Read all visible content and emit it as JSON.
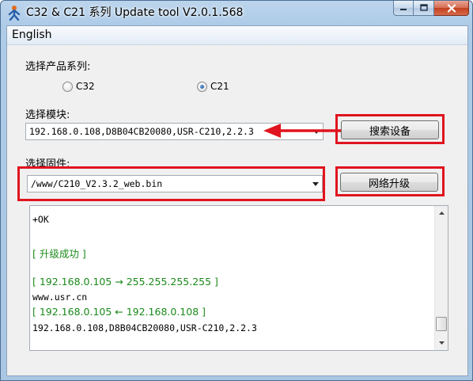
{
  "window": {
    "title": "C32 & C21 系列 Update tool V2.0.1.568"
  },
  "menu": {
    "language": "English"
  },
  "product": {
    "label": "选择产品系列:",
    "options": [
      "C32",
      "C21"
    ],
    "selected": "C21"
  },
  "module": {
    "label": "选择模块:",
    "value": "192.168.0.108,D8B04CB20080,USR-C210,2.2.3",
    "search_button": "搜索设备"
  },
  "firmware": {
    "label": "选择固件:",
    "value": "/www/C210_V2.3.2_web.bin",
    "upgrade_button": "网络升级"
  },
  "log": {
    "lines": [
      {
        "text": "+OK",
        "color": "black"
      },
      {
        "text": "[ 升级成功 ]",
        "color": "green"
      },
      {
        "text": "[ 192.168.0.105 → 255.255.255.255 ]",
        "color": "green"
      },
      {
        "text": "www.usr.cn",
        "color": "black"
      },
      {
        "text": "[ 192.168.0.105 ← 192.168.0.108 ]",
        "color": "green"
      },
      {
        "text": "192.168.0.108,D8B04CB20080,USR-C210,2.2.3",
        "color": "black"
      }
    ]
  },
  "colors": {
    "highlight": "#e0141e",
    "log_green": "#1b8a1b"
  }
}
